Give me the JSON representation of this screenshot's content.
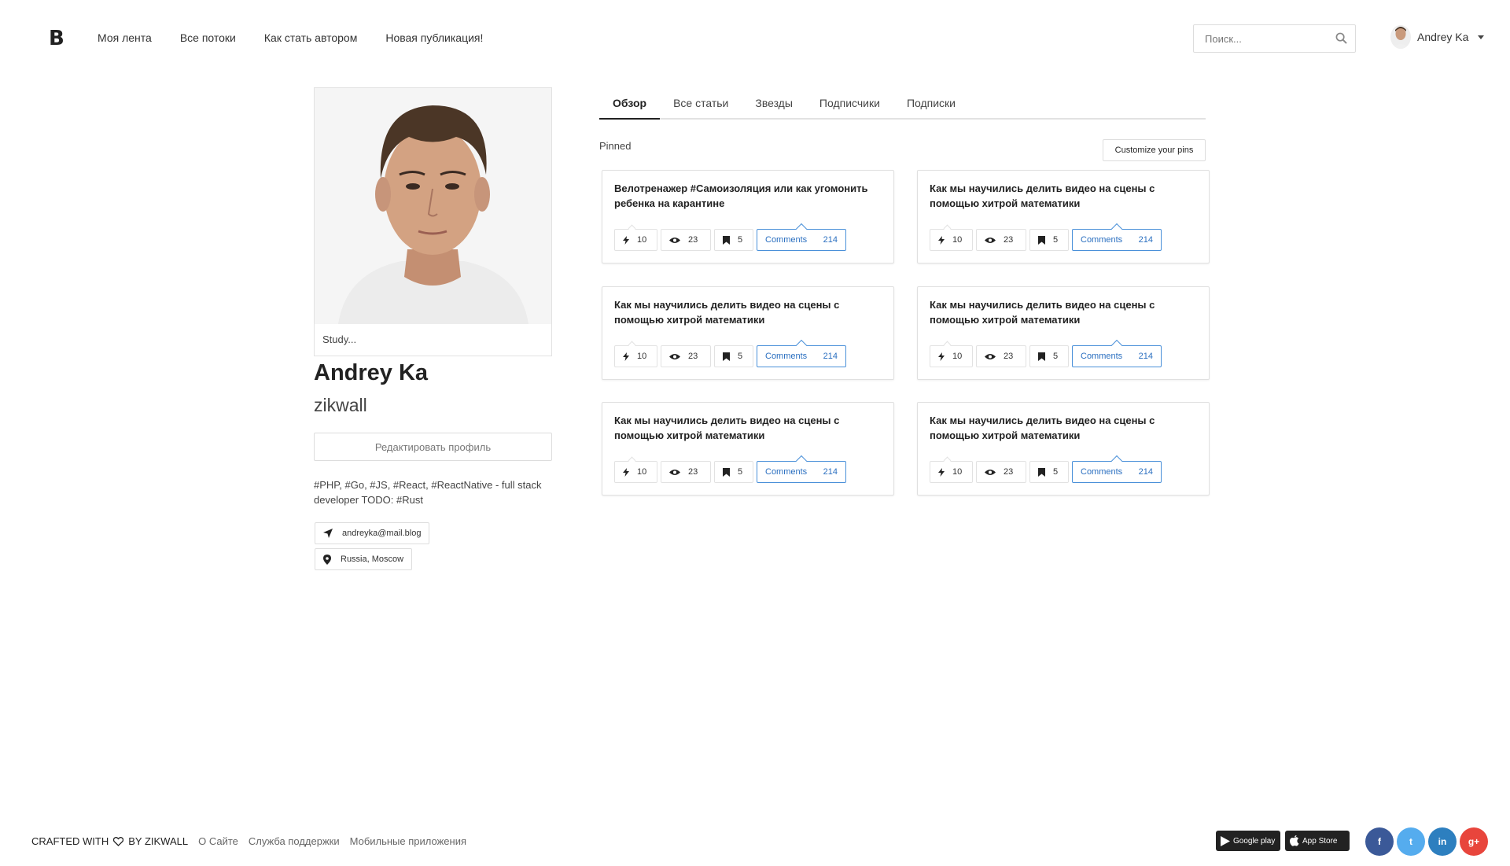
{
  "header": {
    "logo": "B",
    "nav": [
      "Моя лента",
      "Все потоки",
      "Как стать автором",
      "Новая публикация!"
    ],
    "search_placeholder": "Поиск...",
    "user_name": "Andrey Ka"
  },
  "profile": {
    "study": "Study...",
    "name": "Andrey Ka",
    "login": "zikwall",
    "edit_label": "Редактировать профиль",
    "bio": "#PHP, #Go, #JS, #React, #ReactNative - full stack developer TODO: #Rust",
    "email": "andreyka@mail.blog",
    "location": "Russia, Moscow"
  },
  "tabs": [
    "Обзор",
    "Все статьи",
    "Звезды",
    "Подписчики",
    "Подписки"
  ],
  "pinned": {
    "label": "Pinned",
    "customize_label": "Customize your pins",
    "cards": [
      {
        "title": "Велотренажер #Самоизоляция или как угомонить ребенка на карантине",
        "rating": "10",
        "views": "23",
        "bookmarks": "5",
        "comments_label": "Comments",
        "comments": "214"
      },
      {
        "title": "Как мы научились делить видео на сцены с помощью хитрой математики",
        "rating": "10",
        "views": "23",
        "bookmarks": "5",
        "comments_label": "Comments",
        "comments": "214"
      },
      {
        "title": "Как мы научились делить видео на сцены с помощью хитрой математики",
        "rating": "10",
        "views": "23",
        "bookmarks": "5",
        "comments_label": "Comments",
        "comments": "214"
      },
      {
        "title": "Как мы научились делить видео на сцены с помощью хитрой математики",
        "rating": "10",
        "views": "23",
        "bookmarks": "5",
        "comments_label": "Comments",
        "comments": "214"
      },
      {
        "title": "Как мы научились делить видео на сцены с помощью хитрой математики",
        "rating": "10",
        "views": "23",
        "bookmarks": "5",
        "comments_label": "Comments",
        "comments": "214"
      },
      {
        "title": "Как мы научились делить видео на сцены с помощью хитрой математики",
        "rating": "10",
        "views": "23",
        "bookmarks": "5",
        "comments_label": "Comments",
        "comments": "214"
      }
    ]
  },
  "footer": {
    "crafted_prefix": "CRAFTED WITH",
    "crafted_suffix": "BY ZIKWALL",
    "links": [
      "О Сайте",
      "Служба поддержки",
      "Мобильные приложения"
    ],
    "google_play": "Google play",
    "app_store": "App Store",
    "social": [
      {
        "icon": "facebook-icon",
        "glyph": "f",
        "color": "#3b5998"
      },
      {
        "icon": "twitter-icon",
        "glyph": "t",
        "color": "#55acee"
      },
      {
        "icon": "linkedin-icon",
        "glyph": "in",
        "color": "#2d7fbf"
      },
      {
        "icon": "google-plus-icon",
        "glyph": "g+",
        "color": "#e8453c"
      }
    ]
  },
  "colors": {
    "accent": "#4a90d9",
    "accent_text": "#2a6fc0"
  }
}
